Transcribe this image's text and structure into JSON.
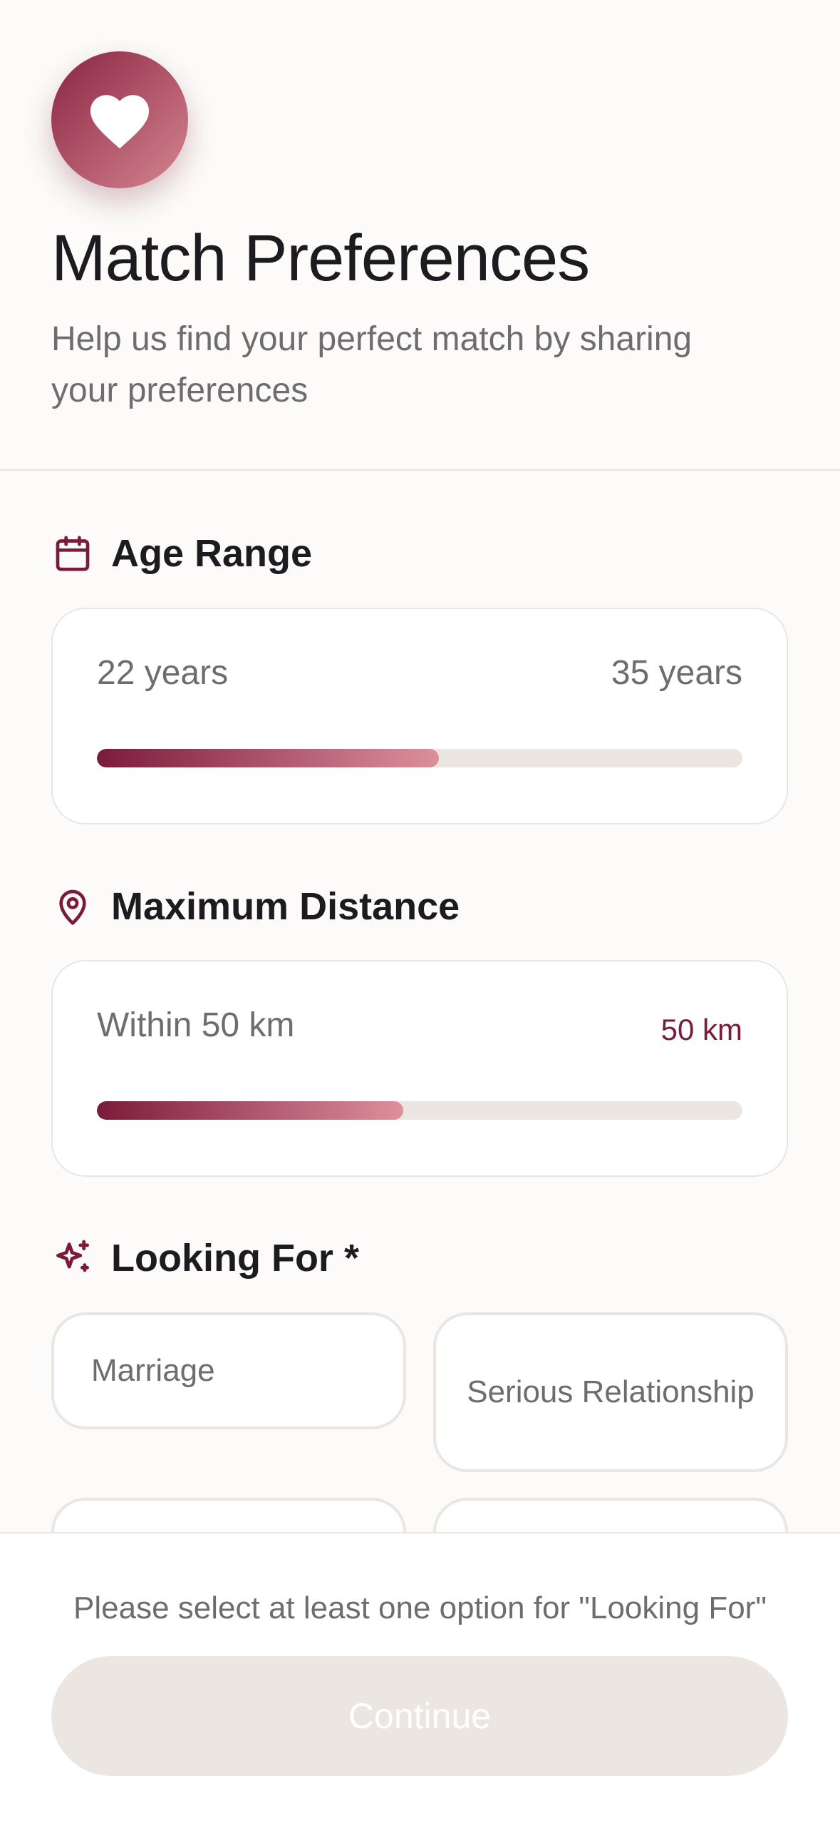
{
  "header": {
    "icon": "heart-icon",
    "title": "Match Preferences",
    "subtitle": "Help us find your perfect match by sharing your preferences"
  },
  "age_range": {
    "icon": "calendar-icon",
    "label": "Age Range",
    "min_label": "22 years",
    "max_label": "35 years",
    "fill_fraction": 0.53
  },
  "distance": {
    "icon": "map-pin-icon",
    "label": "Maximum Distance",
    "description": "Within 50 km",
    "value": "50 km",
    "fill_fraction": 0.475
  },
  "looking_for": {
    "icon": "sparkles-icon",
    "label": "Looking For *",
    "options": [
      "Marriage",
      "Serious Relationship"
    ]
  },
  "footer": {
    "note": "Please select at least one option for \"Looking For\"",
    "continue_label": "Continue"
  },
  "colors": {
    "accent": "#7a1b3a",
    "background": "#fcfbf9",
    "disabled_button": "#ebe6e1"
  }
}
